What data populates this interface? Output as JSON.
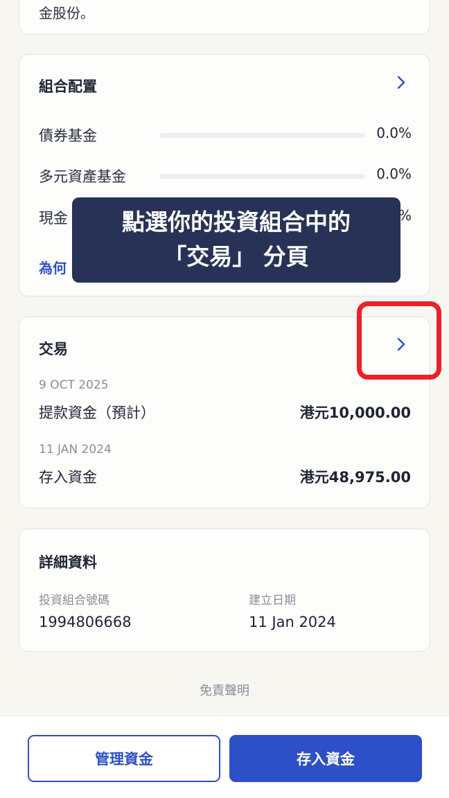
{
  "top_card": {
    "fragment": "金股份。"
  },
  "allocation": {
    "title": "組合配置",
    "rows": [
      {
        "label": "債券基金",
        "percent": "0.0%",
        "fill": 0
      },
      {
        "label": "多元資產基金",
        "percent": "0.0%",
        "fill": 0
      },
      {
        "label": "現金",
        "percent": "%",
        "fill": 0
      }
    ],
    "why_link": "為何"
  },
  "tooltip": {
    "line1": "點選你的投資組合中的",
    "line2": "「交易」 分頁"
  },
  "transactions": {
    "title": "交易",
    "items": [
      {
        "date": "9 OCT 2025",
        "label": "提款資金（預計）",
        "amount": "港元10,000.00"
      },
      {
        "date": "11 JAN 2024",
        "label": "存入資金",
        "amount": "港元48,975.00"
      }
    ]
  },
  "details": {
    "title": "詳細資料",
    "portfolio_number_label": "投資組合號碼",
    "portfolio_number": "1994806668",
    "created_label": "建立日期",
    "created_date": "11 Jan 2024"
  },
  "disclaimer": "免責聲明",
  "buttons": {
    "manage": "管理資金",
    "deposit": "存入資金"
  },
  "colors": {
    "accent": "#2d4fc7",
    "tooltip_bg": "#273256",
    "highlight": "#ec2027"
  }
}
